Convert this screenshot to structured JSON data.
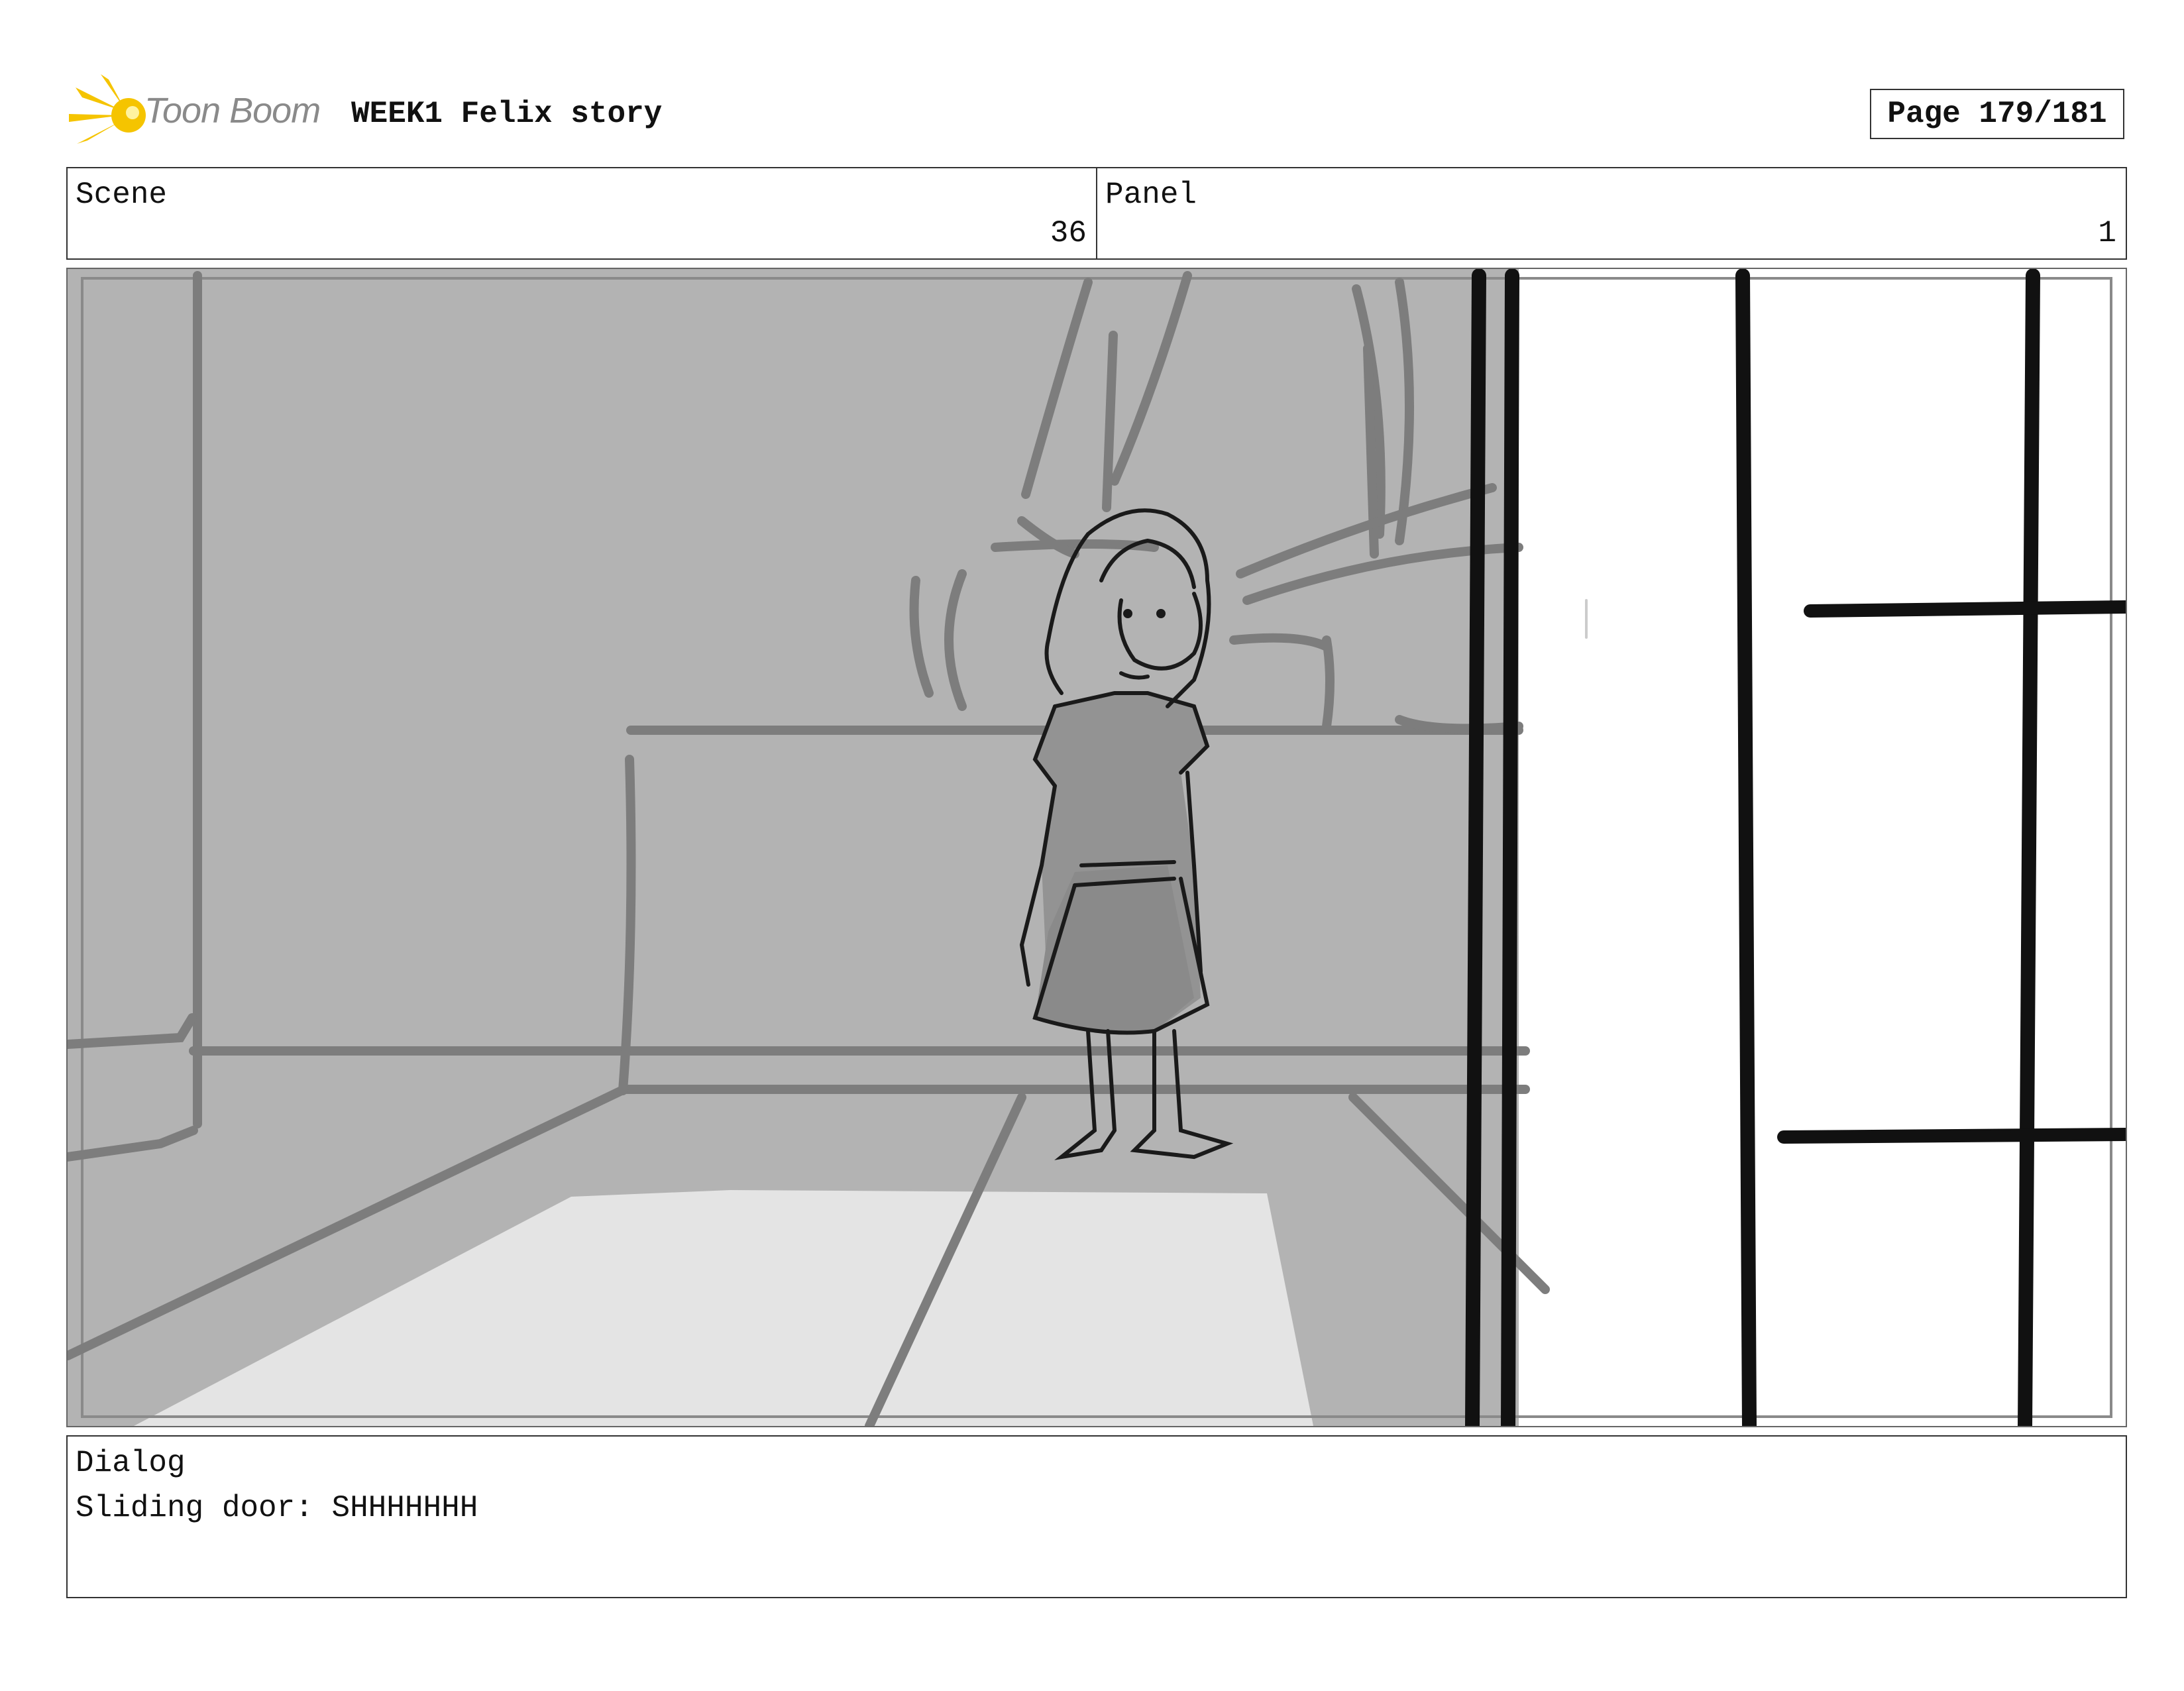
{
  "header": {
    "brand": "Toon Boom",
    "title": "WEEK1 Felix story",
    "page": "Page 179/181"
  },
  "info": {
    "scene_label": "Scene",
    "scene_value": "36",
    "panel_label": "Panel",
    "panel_value": "1"
  },
  "dialog": {
    "label": "Dialog",
    "text": "Sliding door: SHHHHHHH"
  },
  "colors": {
    "logo_accent": "#f5c400",
    "wall_gray": "#b3b3b3",
    "sketch_line": "#7d7d7d",
    "floor_light": "#e4e4e4",
    "door_frame": "#111111"
  }
}
